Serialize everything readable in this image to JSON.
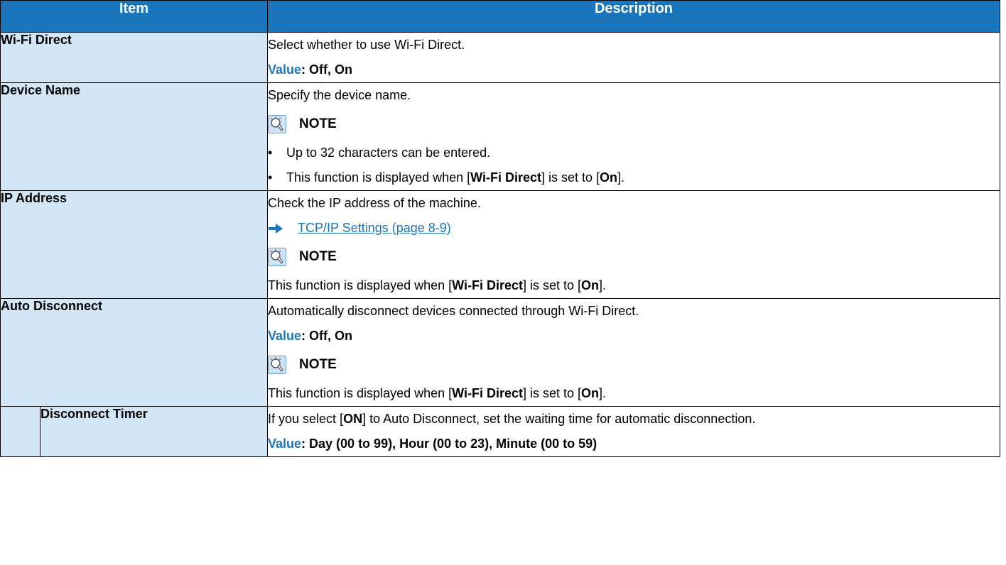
{
  "header": {
    "item": "Item",
    "description": "Description"
  },
  "rows": {
    "wifi_direct": {
      "item": "Wi-Fi Direct",
      "desc": "Select whether to use Wi-Fi Direct.",
      "value_label": "Value",
      "value_text": ": Off, On"
    },
    "device_name": {
      "item": "Device Name",
      "desc": "Specify the device name.",
      "note_title": "NOTE",
      "bullet1": "Up to 32 characters can be entered.",
      "bullet2_pre": "This function is displayed when [",
      "bullet2_b1": "Wi-Fi Direct",
      "bullet2_mid": "] is set to [",
      "bullet2_b2": "On",
      "bullet2_post": "]."
    },
    "ip_address": {
      "item": "IP Address",
      "desc": "Check the IP address of the machine.",
      "link": "TCP/IP Settings (page 8-9)",
      "note_title": "NOTE",
      "note_pre": "This function is displayed when [",
      "note_b1": "Wi-Fi Direct",
      "note_mid": "] is set to [",
      "note_b2": "On",
      "note_post": "]."
    },
    "auto_disconnect": {
      "item": "Auto Disconnect",
      "desc": "Automatically disconnect devices connected through Wi-Fi Direct.",
      "value_label": "Value",
      "value_text": ": Off, On",
      "note_title": "NOTE",
      "note_pre": "This function is displayed when [",
      "note_b1": "Wi-Fi Direct",
      "note_mid": "] is set to [",
      "note_b2": "On",
      "note_post": "]."
    },
    "disconnect_timer": {
      "item": "Disconnect Timer",
      "desc_pre": "If you select [",
      "desc_b": "ON",
      "desc_post": "] to Auto Disconnect, set the waiting time for automatic disconnection.",
      "value_label": "Value",
      "value_text": ": Day (00 to 99), Hour (00 to 23), Minute (00 to 59)"
    }
  },
  "icons": {
    "note": "lightbulb-note-icon",
    "xref": "arrow-right-icon"
  },
  "colors": {
    "header_bg": "#1b75bb",
    "item_bg": "#d2e6f5",
    "accent": "#1b75bb"
  }
}
